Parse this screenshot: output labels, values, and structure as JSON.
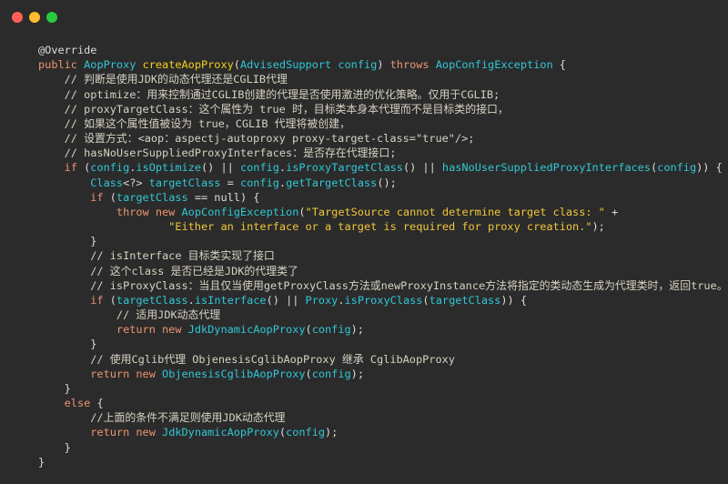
{
  "window": {
    "controls": [
      {
        "name": "close",
        "color": "#fe5f57"
      },
      {
        "name": "minimize",
        "color": "#febc2e"
      },
      {
        "name": "zoom",
        "color": "#28c840"
      }
    ]
  },
  "colors": {
    "background": "#2b2b2b",
    "keyword": "#ec9470",
    "type": "#2fc8d6",
    "method": "#f2d01a",
    "string": "#f2c73a",
    "comment": "#d6d2c2",
    "plain": "#dcdcdc"
  },
  "code": {
    "lines": [
      {
        "tokens": [
          {
            "c": "p",
            "s": "@Override"
          }
        ]
      },
      {
        "tokens": [
          {
            "c": "kw",
            "s": "public "
          },
          {
            "c": "ty",
            "s": "AopProxy "
          },
          {
            "c": "fn",
            "s": "createAopProxy"
          },
          {
            "c": "p",
            "s": "("
          },
          {
            "c": "ty",
            "s": "AdvisedSupport config"
          },
          {
            "c": "p",
            "s": ") "
          },
          {
            "c": "kw",
            "s": "throws "
          },
          {
            "c": "ty",
            "s": "AopConfigException"
          },
          {
            "c": "p",
            "s": " {"
          }
        ]
      },
      {
        "tokens": [
          {
            "c": "cm",
            "s": "    // 判断是使用JDK的动态代理还是CGLIB代理"
          }
        ]
      },
      {
        "tokens": [
          {
            "c": "cm",
            "s": "    // optimize：用来控制通过CGLIB创建的代理是否使用激进的优化策略。仅用于CGLIB;"
          }
        ]
      },
      {
        "tokens": [
          {
            "c": "cm",
            "s": "    // proxyTargetClass：这个属性为 true 时，目标类本身本代理而不是目标类的接口，"
          }
        ]
      },
      {
        "tokens": [
          {
            "c": "cm",
            "s": "    // 如果这个属性值被设为 true，CGLIB 代理将被创建，"
          }
        ]
      },
      {
        "tokens": [
          {
            "c": "cm",
            "s": "    // 设置方式：<aop：aspectj-autoproxy proxy-target-class=\"true\"/>;"
          }
        ]
      },
      {
        "tokens": [
          {
            "c": "cm",
            "s": "    // hasNoUserSuppliedProxyInterfaces：是否存在代理接口;"
          }
        ]
      },
      {
        "tokens": [
          {
            "c": "kw",
            "s": "    if "
          },
          {
            "c": "p",
            "s": "("
          },
          {
            "c": "ty",
            "s": "config"
          },
          {
            "c": "p",
            "s": "."
          },
          {
            "c": "ty",
            "s": "isOptimize"
          },
          {
            "c": "p",
            "s": "() || "
          },
          {
            "c": "ty",
            "s": "config"
          },
          {
            "c": "p",
            "s": "."
          },
          {
            "c": "ty",
            "s": "isProxyTargetClass"
          },
          {
            "c": "p",
            "s": "() || "
          },
          {
            "c": "ty",
            "s": "hasNoUserSuppliedProxyInterfaces"
          },
          {
            "c": "p",
            "s": "("
          },
          {
            "c": "ty",
            "s": "config"
          },
          {
            "c": "p",
            "s": ")) {"
          }
        ]
      },
      {
        "tokens": [
          {
            "c": "ty",
            "s": "        Class"
          },
          {
            "c": "p",
            "s": "<?> "
          },
          {
            "c": "ty",
            "s": "targetClass"
          },
          {
            "c": "p",
            "s": " = "
          },
          {
            "c": "ty",
            "s": "config"
          },
          {
            "c": "p",
            "s": "."
          },
          {
            "c": "ty",
            "s": "getTargetClass"
          },
          {
            "c": "p",
            "s": "();"
          }
        ]
      },
      {
        "tokens": [
          {
            "c": "kw",
            "s": "        if "
          },
          {
            "c": "p",
            "s": "("
          },
          {
            "c": "ty",
            "s": "targetClass"
          },
          {
            "c": "p",
            "s": " == null) {"
          }
        ]
      },
      {
        "tokens": [
          {
            "c": "kw",
            "s": "            throw new "
          },
          {
            "c": "ty",
            "s": "AopConfigException"
          },
          {
            "c": "p",
            "s": "("
          },
          {
            "c": "st",
            "s": "\"TargetSource cannot determine target class: \""
          },
          {
            "c": "p",
            "s": " +"
          }
        ]
      },
      {
        "tokens": [
          {
            "c": "st",
            "s": "                    \"Either an interface or a target is required for proxy creation.\""
          },
          {
            "c": "p",
            "s": ");"
          }
        ]
      },
      {
        "tokens": [
          {
            "c": "p",
            "s": "        }"
          }
        ]
      },
      {
        "tokens": [
          {
            "c": "cm",
            "s": "        // isInterface 目标类实现了接口"
          }
        ]
      },
      {
        "tokens": [
          {
            "c": "cm",
            "s": "        // 这个class 是否已经是JDK的代理类了"
          }
        ]
      },
      {
        "tokens": [
          {
            "c": "cm",
            "s": "        // isProxyClass：当且仅当使用getProxyClass方法或newProxyInstance方法将指定的类动态生成为代理类时，返回true。"
          }
        ]
      },
      {
        "tokens": [
          {
            "c": "kw",
            "s": "        if "
          },
          {
            "c": "p",
            "s": "("
          },
          {
            "c": "ty",
            "s": "targetClass"
          },
          {
            "c": "p",
            "s": "."
          },
          {
            "c": "ty",
            "s": "isInterface"
          },
          {
            "c": "p",
            "s": "() || "
          },
          {
            "c": "ty",
            "s": "Proxy"
          },
          {
            "c": "p",
            "s": "."
          },
          {
            "c": "ty",
            "s": "isProxyClass"
          },
          {
            "c": "p",
            "s": "("
          },
          {
            "c": "ty",
            "s": "targetClass"
          },
          {
            "c": "p",
            "s": ")) {"
          }
        ]
      },
      {
        "tokens": [
          {
            "c": "cm",
            "s": "            // 适用JDK动态代理"
          }
        ]
      },
      {
        "tokens": [
          {
            "c": "kw",
            "s": "            return new "
          },
          {
            "c": "ty",
            "s": "JdkDynamicAopProxy"
          },
          {
            "c": "p",
            "s": "("
          },
          {
            "c": "ty",
            "s": "config"
          },
          {
            "c": "p",
            "s": ");"
          }
        ]
      },
      {
        "tokens": [
          {
            "c": "p",
            "s": "        }"
          }
        ]
      },
      {
        "tokens": [
          {
            "c": "cm",
            "s": "        // 使用Cglib代理 ObjenesisCglibAopProxy 继承 CglibAopProxy"
          }
        ]
      },
      {
        "tokens": [
          {
            "c": "kw",
            "s": "        return new "
          },
          {
            "c": "ty",
            "s": "ObjenesisCglibAopProxy"
          },
          {
            "c": "p",
            "s": "("
          },
          {
            "c": "ty",
            "s": "config"
          },
          {
            "c": "p",
            "s": ");"
          }
        ]
      },
      {
        "tokens": [
          {
            "c": "p",
            "s": "    }"
          }
        ]
      },
      {
        "tokens": [
          {
            "c": "kw",
            "s": "    else "
          },
          {
            "c": "p",
            "s": "{"
          }
        ]
      },
      {
        "tokens": [
          {
            "c": "cm",
            "s": "        //上面的条件不满足则使用JDK动态代理"
          }
        ]
      },
      {
        "tokens": [
          {
            "c": "kw",
            "s": "        return new "
          },
          {
            "c": "ty",
            "s": "JdkDynamicAopProxy"
          },
          {
            "c": "p",
            "s": "("
          },
          {
            "c": "ty",
            "s": "config"
          },
          {
            "c": "p",
            "s": ");"
          }
        ]
      },
      {
        "tokens": [
          {
            "c": "p",
            "s": "    }"
          }
        ]
      },
      {
        "tokens": [
          {
            "c": "p",
            "s": "}"
          }
        ]
      }
    ]
  }
}
